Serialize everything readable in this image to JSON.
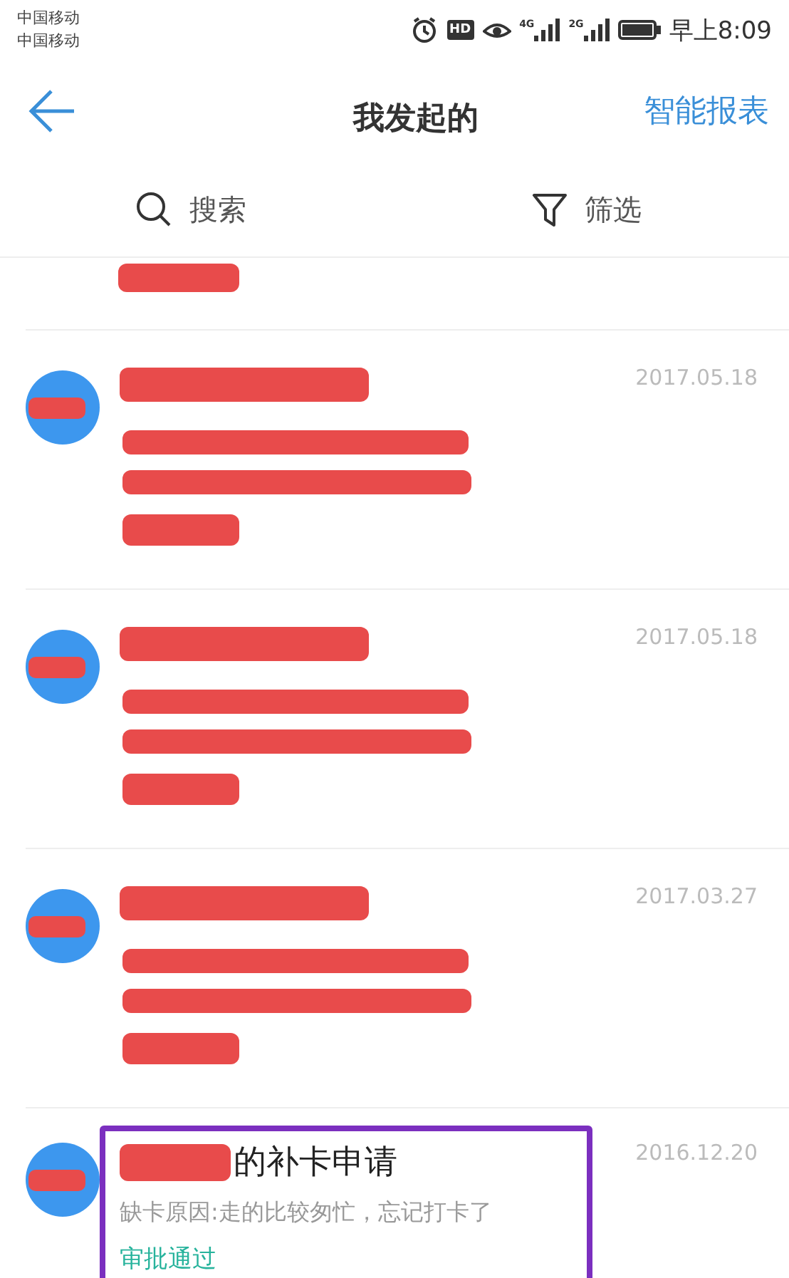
{
  "status_bar": {
    "carriers": [
      "中国移动",
      "中国移动"
    ],
    "hd": "HD",
    "networks": [
      "4G",
      "2G"
    ],
    "time": "早上8:09"
  },
  "header": {
    "title": "我发起的",
    "action": "智能报表"
  },
  "toolbar": {
    "search": "搜索",
    "filter": "筛选"
  },
  "items": [
    {
      "kind": "redacted-tail"
    },
    {
      "kind": "redacted",
      "date": "2017.05.18"
    },
    {
      "kind": "redacted",
      "date": "2017.05.18"
    },
    {
      "kind": "redacted",
      "date": "2017.03.27"
    },
    {
      "kind": "partial",
      "date": "2016.12.20",
      "title": "的补卡申请",
      "reason": "缺卡原因:走的比较匆忙，忘记打卡了",
      "status": "审批通过",
      "highlighted": true
    }
  ]
}
